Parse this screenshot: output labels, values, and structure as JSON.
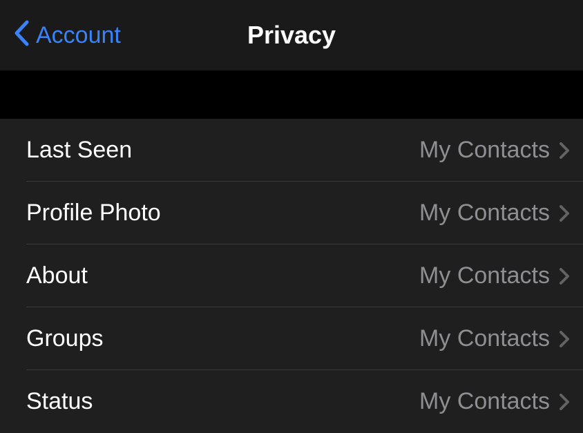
{
  "nav": {
    "back_label": "Account",
    "title": "Privacy"
  },
  "settings": {
    "items": [
      {
        "label": "Last Seen",
        "value": "My Contacts"
      },
      {
        "label": "Profile Photo",
        "value": "My Contacts"
      },
      {
        "label": "About",
        "value": "My Contacts"
      },
      {
        "label": "Groups",
        "value": "My Contacts"
      },
      {
        "label": "Status",
        "value": "My Contacts"
      }
    ]
  }
}
